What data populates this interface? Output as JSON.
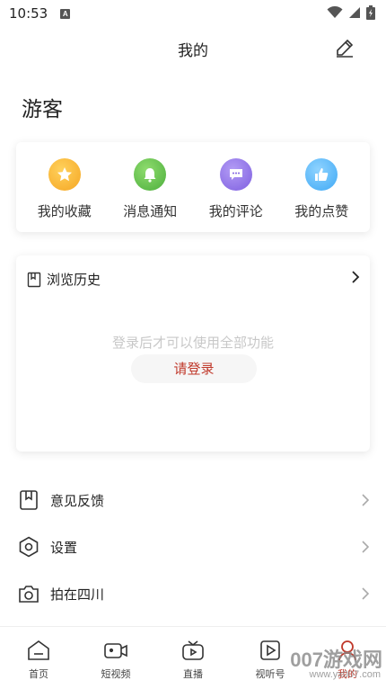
{
  "status_bar": {
    "time": "10:53",
    "notification_icon": "A"
  },
  "header": {
    "title": "我的",
    "edit_icon": "pencil-icon"
  },
  "profile": {
    "username": "游客"
  },
  "quick_actions": [
    {
      "label": "我的收藏",
      "icon": "star-icon",
      "color": "#f5a623"
    },
    {
      "label": "消息通知",
      "icon": "bell-icon",
      "color": "#5cb85c"
    },
    {
      "label": "我的评论",
      "icon": "comment-icon",
      "color": "#8e6fe0"
    },
    {
      "label": "我的点赞",
      "icon": "thumbs-up-icon",
      "color": "#3fa9f5"
    }
  ],
  "history": {
    "title": "浏览历史",
    "hint": "登录后才可以使用全部功能",
    "login_label": "请登录"
  },
  "menu": [
    {
      "label": "意见反馈",
      "icon": "bookmark-icon"
    },
    {
      "label": "设置",
      "icon": "settings-hexagon-icon"
    },
    {
      "label": "拍在四川",
      "icon": "camera-icon"
    }
  ],
  "tabbar": [
    {
      "label": "首页",
      "icon": "home-icon",
      "active": false
    },
    {
      "label": "短视频",
      "icon": "video-camera-icon",
      "active": false
    },
    {
      "label": "直播",
      "icon": "tv-icon",
      "active": false
    },
    {
      "label": "视听号",
      "icon": "play-square-icon",
      "active": false
    },
    {
      "label": "我的",
      "icon": "user-icon",
      "active": true
    }
  ],
  "watermark": {
    "text": "007游戏网",
    "url": "www.yx007.com"
  },
  "colors": {
    "accent": "#c0392b",
    "hint": "#c8c8c8"
  }
}
